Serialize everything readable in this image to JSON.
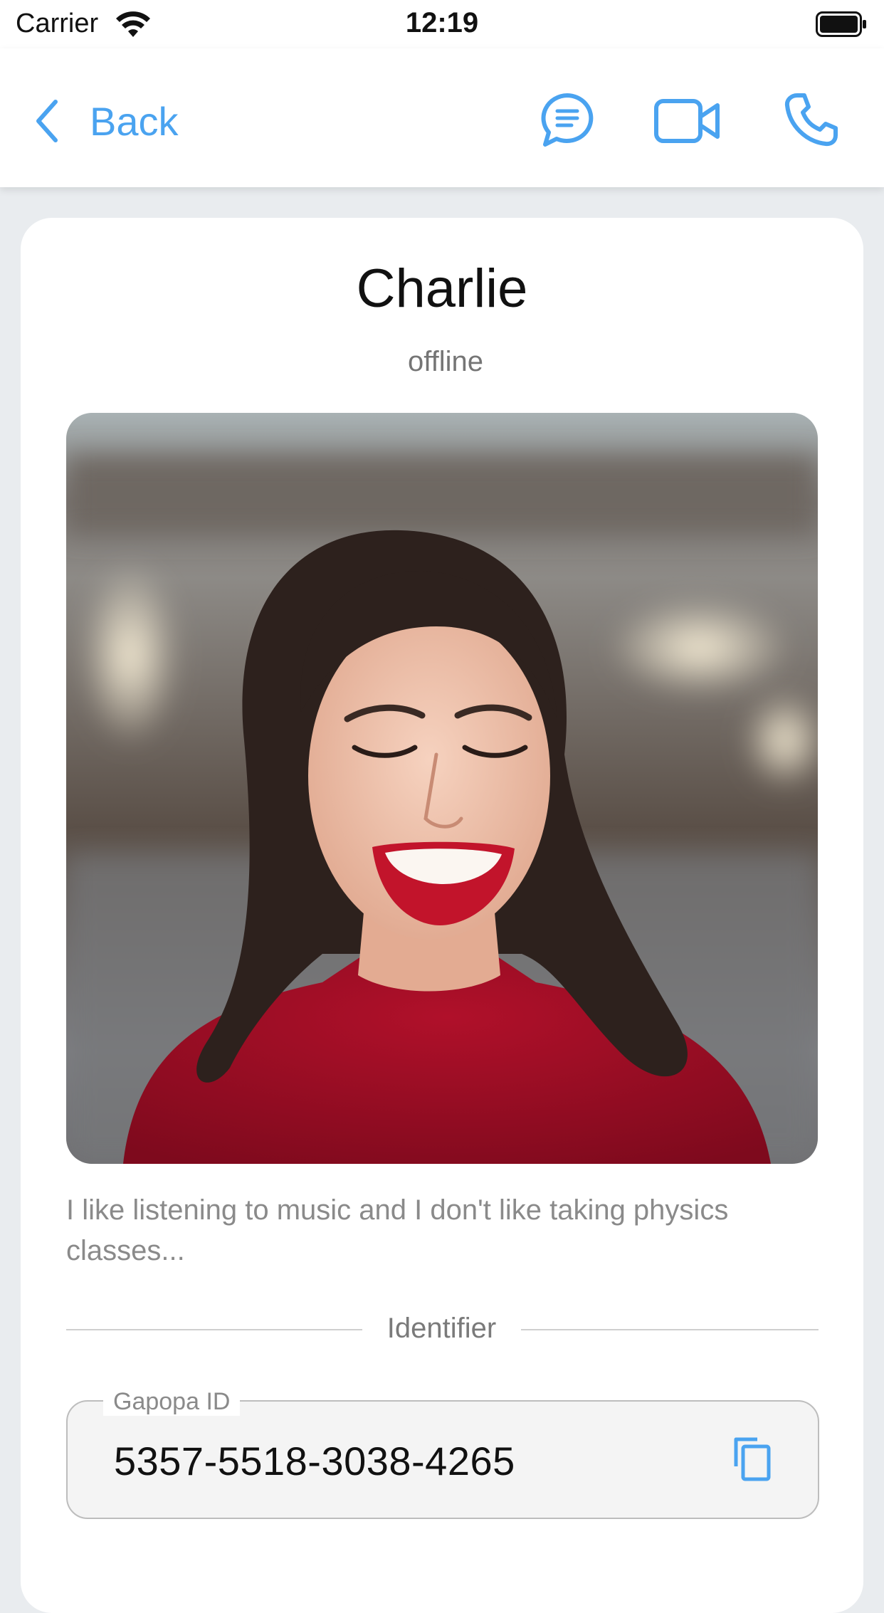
{
  "status_bar": {
    "carrier": "Carrier",
    "time": "12:19"
  },
  "nav": {
    "back_label": "Back",
    "icons": [
      "chevron-left-icon",
      "chat-icon",
      "video-call-icon",
      "phone-icon"
    ],
    "accent_color": "#4aa3f0"
  },
  "profile": {
    "name": "Charlie",
    "status": "offline",
    "photo": "profile-photo",
    "bio": "I like listening to music and I don't like taking physics classes...",
    "section_title": "Identifier",
    "id_field": {
      "label": "Gapopa ID",
      "value": "5357-5518-3038-4265",
      "action_icon": "copy-icon"
    }
  }
}
